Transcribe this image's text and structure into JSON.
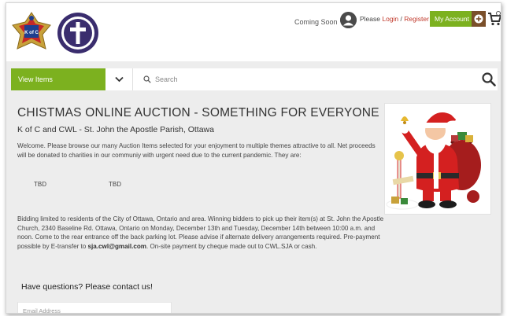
{
  "header": {
    "coming_soon": "Coming Soon",
    "please": "Please ",
    "login": "Login",
    "separator": " / ",
    "register": "Register",
    "my_account": "My Account",
    "logo_kofc_text": "K of C"
  },
  "search": {
    "view_items": "View Items",
    "placeholder": "Search"
  },
  "content": {
    "title": "CHISTMAS ONLINE AUCTION - SOMETHING FOR EVERYONE",
    "subtitle": "K of C and CWL - St. John the Apostle Parish, Ottawa",
    "intro": "Welcome. Please browse our many Auction Items selected for your enjoyment to multiple themes attractive to all. Net proceeds will be donated to charities in our communiy with urgent need due to the current pandemic. They are:",
    "tbd_1": "TBD",
    "tbd_2": "TBD",
    "bidding_pre": "Bidding limited to residents of the City of Ottawa, Ontario and area. Winning bidders to pick up their item(s) at St. John the Apostle Church, 2340 Baseline Rd. Ottawa, Ontario on Monday, December 13th and Tuesday, December 14th between 10:00 a.m. and noon. Come to the rear entrance off the back parking lot. Please advise if alternate delivery arrangements required. Pre-payment possible by E-transfer to ",
    "bidding_email": "sja.cwl@gmail.com",
    "bidding_post": ". On-site payment by cheque made out to CWL.SJA or cash."
  },
  "contact": {
    "heading": "Have questions? Please contact us!",
    "email_placeholder": "Email Address"
  },
  "colors": {
    "accent_green": "#7cb11f",
    "brown": "#7a4f2a",
    "link_red": "#c0392b"
  },
  "icons": [
    "kofc-logo",
    "cwl-logo",
    "user-icon",
    "plus-circle-icon",
    "cart-icon",
    "chevron-down-icon",
    "search-icon",
    "santa-image"
  ]
}
